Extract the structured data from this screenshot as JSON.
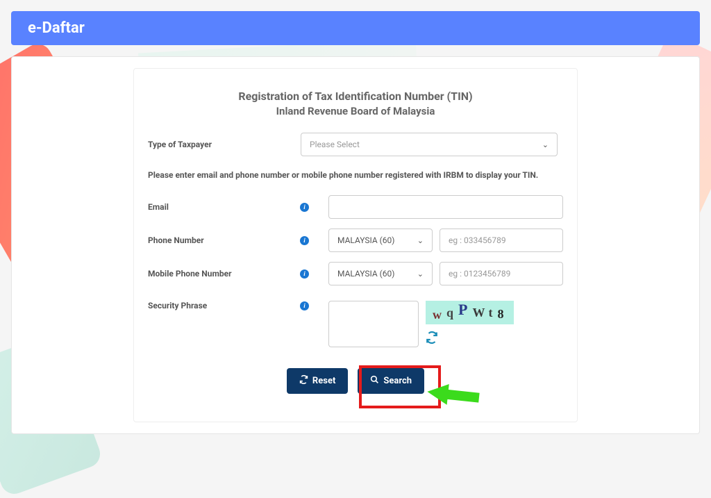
{
  "header": {
    "title": "e-Daftar"
  },
  "form": {
    "title": "Registration of Tax Identification Number (TIN)",
    "subtitle": "Inland Revenue Board of Malaysia",
    "instruction": "Please enter email and phone number or mobile phone number registered with IRBM to display your TIN.",
    "taxpayer": {
      "label": "Type of Taxpayer",
      "placeholder": "Please Select"
    },
    "email": {
      "label": "Email",
      "value": ""
    },
    "phone": {
      "label": "Phone Number",
      "country": "MALAYSIA (60)",
      "placeholder": "eg : 033456789"
    },
    "mobile": {
      "label": "Mobile Phone Number",
      "country": "MALAYSIA (60)",
      "placeholder": "eg : 0123456789"
    },
    "security": {
      "label": "Security Phrase",
      "captcha": [
        "w",
        "q",
        "P",
        "Wt",
        "8"
      ]
    },
    "buttons": {
      "reset": "Reset",
      "search": "Search"
    }
  }
}
